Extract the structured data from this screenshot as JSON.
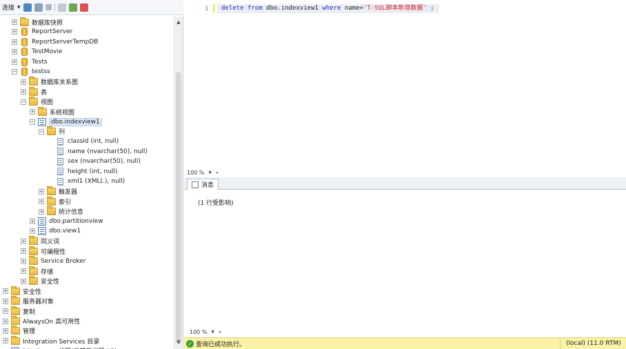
{
  "object_explorer": {
    "toolbar": {
      "connect_label": "连接"
    },
    "tree": [
      {
        "label": "数据库快照",
        "icon": "folder-icon",
        "expander": "+",
        "level": 3
      },
      {
        "label": "ReportServer",
        "icon": "database-icon",
        "expander": "+",
        "level": 3
      },
      {
        "label": "ReportServerTempDB",
        "icon": "database-icon",
        "expander": "+",
        "level": 3
      },
      {
        "label": "TestMovie",
        "icon": "database-icon",
        "expander": "+",
        "level": 3
      },
      {
        "label": "Tests",
        "icon": "database-icon",
        "expander": "+",
        "level": 3
      },
      {
        "label": "testss",
        "icon": "database-icon",
        "expander": "-",
        "level": 3
      },
      {
        "label": "数据库关系图",
        "icon": "folder-icon",
        "expander": "+",
        "level": 4
      },
      {
        "label": "表",
        "icon": "folder-icon",
        "expander": "+",
        "level": 4
      },
      {
        "label": "视图",
        "icon": "folder-icon",
        "expander": "-",
        "level": 4
      },
      {
        "label": "系统视图",
        "icon": "folder-icon",
        "expander": "+",
        "level": 5
      },
      {
        "label": "dbo.indexview1",
        "icon": "view-icon",
        "expander": "-",
        "level": 5,
        "selected": true
      },
      {
        "label": "列",
        "icon": "folder-icon",
        "expander": "-",
        "level": 6
      },
      {
        "label": "classid (int, null)",
        "icon": "column-icon",
        "expander": "",
        "level": 7
      },
      {
        "label": "name (nvarchar(50), null)",
        "icon": "column-icon",
        "expander": "",
        "level": 7
      },
      {
        "label": "sex (nvarchar(50), null)",
        "icon": "column-icon",
        "expander": "",
        "level": 7
      },
      {
        "label": "height (int, null)",
        "icon": "column-icon",
        "expander": "",
        "level": 7
      },
      {
        "label": "xml1 (XML(.), null)",
        "icon": "column-icon",
        "expander": "",
        "level": 7
      },
      {
        "label": "触发器",
        "icon": "folder-icon",
        "expander": "+",
        "level": 6
      },
      {
        "label": "索引",
        "icon": "folder-icon",
        "expander": "+",
        "level": 6
      },
      {
        "label": "统计信息",
        "icon": "folder-icon",
        "expander": "+",
        "level": 6
      },
      {
        "label": "dbo.partitionview",
        "icon": "view-icon",
        "expander": "+",
        "level": 5
      },
      {
        "label": "dbo.view1",
        "icon": "view-icon",
        "expander": "+",
        "level": 5
      },
      {
        "label": "同义词",
        "icon": "folder-icon",
        "expander": "+",
        "level": 4
      },
      {
        "label": "可编程性",
        "icon": "folder-icon",
        "expander": "+",
        "level": 4
      },
      {
        "label": "Service Broker",
        "icon": "folder-icon",
        "expander": "+",
        "level": 4
      },
      {
        "label": "存储",
        "icon": "folder-icon",
        "expander": "+",
        "level": 4
      },
      {
        "label": "安全性",
        "icon": "folder-icon",
        "expander": "+",
        "level": 4
      },
      {
        "label": "安全性",
        "icon": "folder-icon",
        "expander": "+",
        "level": 2
      },
      {
        "label": "服务器对象",
        "icon": "folder-icon",
        "expander": "+",
        "level": 2
      },
      {
        "label": "复制",
        "icon": "folder-icon",
        "expander": "+",
        "level": 2
      },
      {
        "label": "AlwaysOn 高可用性",
        "icon": "folder-icon",
        "expander": "+",
        "level": 2
      },
      {
        "label": "管理",
        "icon": "folder-icon",
        "expander": "+",
        "level": 2
      },
      {
        "label": "Integration Services 目录",
        "icon": "folder-icon",
        "expander": "+",
        "level": 2
      },
      {
        "label": "SQL Server 代理(已禁用代理 XP)",
        "icon": "agent-icon",
        "expander": "",
        "level": 2
      }
    ]
  },
  "editor": {
    "line_number": "1",
    "code": {
      "kw_delete": "delete",
      "kw_from": "from",
      "table": "dbo.indexview1",
      "kw_where": "where",
      "column": "name=",
      "string": "'T-SQL脚本新增数据'",
      "end": ";"
    },
    "zoom": "100 %"
  },
  "results": {
    "tab_label": "消息",
    "message": "(1 行受影响)",
    "zoom": "100 %"
  },
  "status_bar": {
    "text": "查询已成功执行。",
    "server": "(local) (11.0 RTM)"
  },
  "colors": {
    "status_bar_bg": "#f9f2a8",
    "keyword": "#2323d6",
    "string": "#d0202a",
    "line_number": "#2b91af"
  }
}
